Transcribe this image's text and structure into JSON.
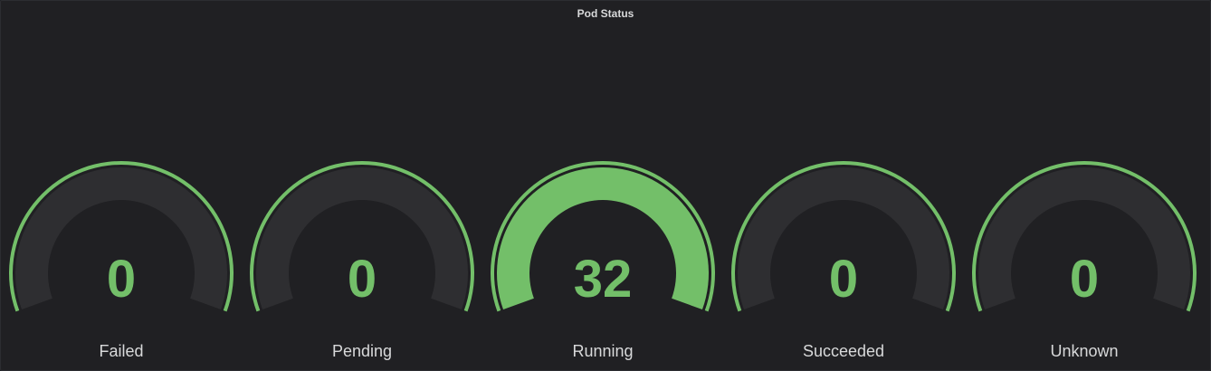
{
  "panel": {
    "title": "Pod Status"
  },
  "colors": {
    "value": "#73bf69",
    "threshold": "#73bf69",
    "track": "#2e2e31",
    "label": "#d8d9da"
  },
  "gauge": {
    "min": 0,
    "max": 32
  },
  "gauges": [
    {
      "label": "Failed",
      "value": "0"
    },
    {
      "label": "Pending",
      "value": "0"
    },
    {
      "label": "Running",
      "value": "32"
    },
    {
      "label": "Succeeded",
      "value": "0"
    },
    {
      "label": "Unknown",
      "value": "0"
    }
  ]
}
